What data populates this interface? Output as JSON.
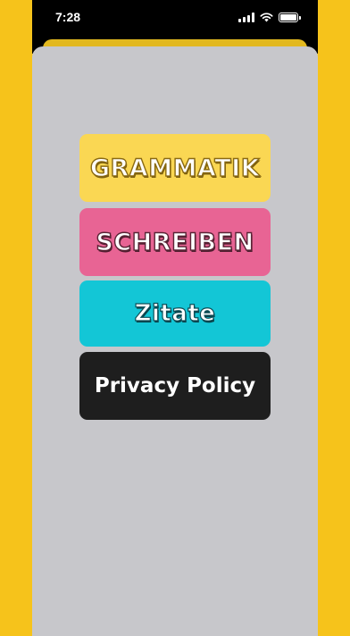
{
  "status_bar": {
    "time": "7:28",
    "battery_level": 1.0
  },
  "menu": {
    "grammatik": "GRAMMATIK",
    "schreiben": "SCHREIBEN",
    "zitate": "Zitate",
    "privacy": "Privacy Policy"
  },
  "colors": {
    "background": "#F6C31B",
    "sheet": "#C7C7CB",
    "grammatik": "#FAD753",
    "schreiben": "#E86494",
    "zitate": "#13C6D6",
    "privacy": "#1E1E1E"
  }
}
